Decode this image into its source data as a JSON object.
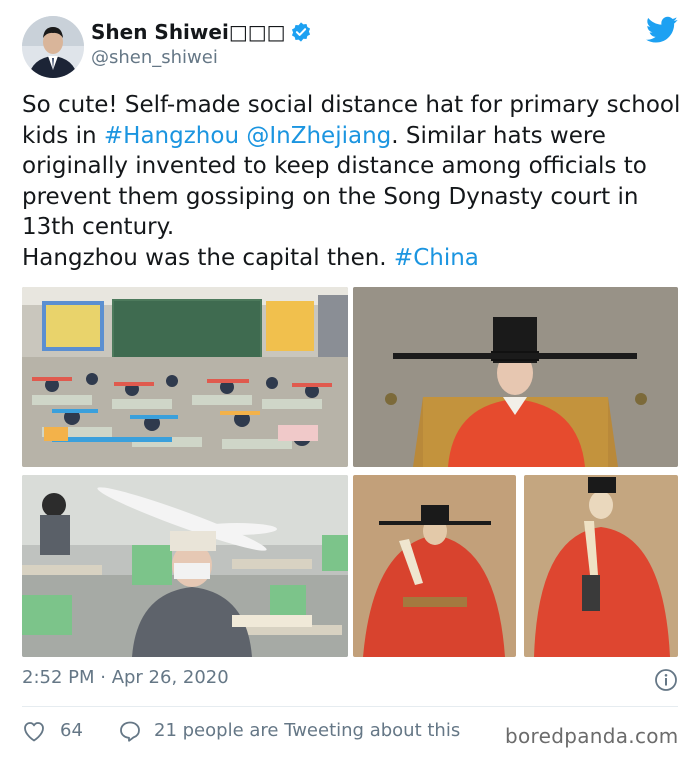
{
  "author": {
    "name": "Shen Shiwei",
    "name_suffix": "□□□",
    "handle": "@shen_shiwei"
  },
  "icons": {
    "verified": "verified-badge-icon",
    "platform": "twitter-bird-icon",
    "info": "info-icon",
    "like": "heart-icon",
    "reply": "speech-bubble-icon"
  },
  "colors": {
    "link": "#1b95e0",
    "twitter_blue": "#1da1f2",
    "secondary_text": "#657786"
  },
  "tweet": {
    "text_1": "So cute! Self-made social distance hat for primary school kids in ",
    "hashtag_1": "#Hangzhou",
    "mention": "@InZhejiang",
    "text_2": ". Similar hats were originally invented to keep distance among officials to prevent them gossiping on the Song Dynasty court in 13th century.",
    "text_3": "Hangzhou was the capital then. ",
    "hashtag_2": "#China"
  },
  "media_images": [
    "classroom-students-wearing-wide-hats",
    "actor-in-red-song-dynasty-robe-and-hat",
    "student-with-balloon-hat-at-desk",
    "song-dynasty-official-portrait",
    "song-dynasty-official-portrait-2"
  ],
  "footer": {
    "timestamp": "2:52 PM · Apr 26, 2020",
    "likes": "64",
    "tweeting_text": "21 people are Tweeting about this"
  },
  "watermark": "boredpanda.com"
}
